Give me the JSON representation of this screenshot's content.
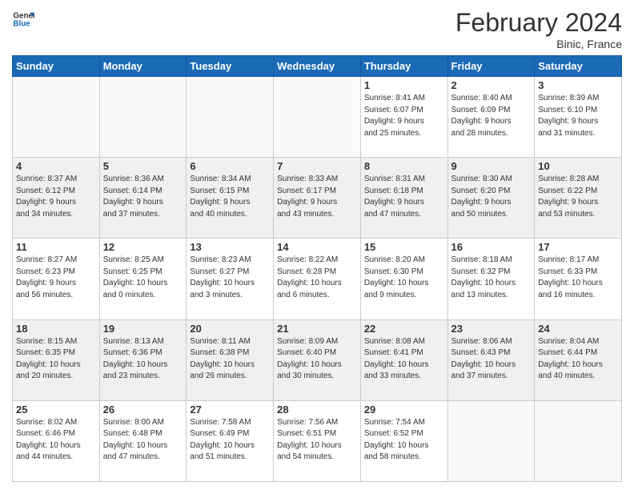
{
  "logo": {
    "line1": "General",
    "line2": "Blue"
  },
  "title": "February 2024",
  "location": "Binic, France",
  "days_of_week": [
    "Sunday",
    "Monday",
    "Tuesday",
    "Wednesday",
    "Thursday",
    "Friday",
    "Saturday"
  ],
  "weeks": [
    [
      {
        "day": "",
        "info": ""
      },
      {
        "day": "",
        "info": ""
      },
      {
        "day": "",
        "info": ""
      },
      {
        "day": "",
        "info": ""
      },
      {
        "day": "1",
        "info": "Sunrise: 8:41 AM\nSunset: 6:07 PM\nDaylight: 9 hours\nand 25 minutes."
      },
      {
        "day": "2",
        "info": "Sunrise: 8:40 AM\nSunset: 6:09 PM\nDaylight: 9 hours\nand 28 minutes."
      },
      {
        "day": "3",
        "info": "Sunrise: 8:39 AM\nSunset: 6:10 PM\nDaylight: 9 hours\nand 31 minutes."
      }
    ],
    [
      {
        "day": "4",
        "info": "Sunrise: 8:37 AM\nSunset: 6:12 PM\nDaylight: 9 hours\nand 34 minutes."
      },
      {
        "day": "5",
        "info": "Sunrise: 8:36 AM\nSunset: 6:14 PM\nDaylight: 9 hours\nand 37 minutes."
      },
      {
        "day": "6",
        "info": "Sunrise: 8:34 AM\nSunset: 6:15 PM\nDaylight: 9 hours\nand 40 minutes."
      },
      {
        "day": "7",
        "info": "Sunrise: 8:33 AM\nSunset: 6:17 PM\nDaylight: 9 hours\nand 43 minutes."
      },
      {
        "day": "8",
        "info": "Sunrise: 8:31 AM\nSunset: 6:18 PM\nDaylight: 9 hours\nand 47 minutes."
      },
      {
        "day": "9",
        "info": "Sunrise: 8:30 AM\nSunset: 6:20 PM\nDaylight: 9 hours\nand 50 minutes."
      },
      {
        "day": "10",
        "info": "Sunrise: 8:28 AM\nSunset: 6:22 PM\nDaylight: 9 hours\nand 53 minutes."
      }
    ],
    [
      {
        "day": "11",
        "info": "Sunrise: 8:27 AM\nSunset: 6:23 PM\nDaylight: 9 hours\nand 56 minutes."
      },
      {
        "day": "12",
        "info": "Sunrise: 8:25 AM\nSunset: 6:25 PM\nDaylight: 10 hours\nand 0 minutes."
      },
      {
        "day": "13",
        "info": "Sunrise: 8:23 AM\nSunset: 6:27 PM\nDaylight: 10 hours\nand 3 minutes."
      },
      {
        "day": "14",
        "info": "Sunrise: 8:22 AM\nSunset: 6:28 PM\nDaylight: 10 hours\nand 6 minutes."
      },
      {
        "day": "15",
        "info": "Sunrise: 8:20 AM\nSunset: 6:30 PM\nDaylight: 10 hours\nand 9 minutes."
      },
      {
        "day": "16",
        "info": "Sunrise: 8:18 AM\nSunset: 6:32 PM\nDaylight: 10 hours\nand 13 minutes."
      },
      {
        "day": "17",
        "info": "Sunrise: 8:17 AM\nSunset: 6:33 PM\nDaylight: 10 hours\nand 16 minutes."
      }
    ],
    [
      {
        "day": "18",
        "info": "Sunrise: 8:15 AM\nSunset: 6:35 PM\nDaylight: 10 hours\nand 20 minutes."
      },
      {
        "day": "19",
        "info": "Sunrise: 8:13 AM\nSunset: 6:36 PM\nDaylight: 10 hours\nand 23 minutes."
      },
      {
        "day": "20",
        "info": "Sunrise: 8:11 AM\nSunset: 6:38 PM\nDaylight: 10 hours\nand 26 minutes."
      },
      {
        "day": "21",
        "info": "Sunrise: 8:09 AM\nSunset: 6:40 PM\nDaylight: 10 hours\nand 30 minutes."
      },
      {
        "day": "22",
        "info": "Sunrise: 8:08 AM\nSunset: 6:41 PM\nDaylight: 10 hours\nand 33 minutes."
      },
      {
        "day": "23",
        "info": "Sunrise: 8:06 AM\nSunset: 6:43 PM\nDaylight: 10 hours\nand 37 minutes."
      },
      {
        "day": "24",
        "info": "Sunrise: 8:04 AM\nSunset: 6:44 PM\nDaylight: 10 hours\nand 40 minutes."
      }
    ],
    [
      {
        "day": "25",
        "info": "Sunrise: 8:02 AM\nSunset: 6:46 PM\nDaylight: 10 hours\nand 44 minutes."
      },
      {
        "day": "26",
        "info": "Sunrise: 8:00 AM\nSunset: 6:48 PM\nDaylight: 10 hours\nand 47 minutes."
      },
      {
        "day": "27",
        "info": "Sunrise: 7:58 AM\nSunset: 6:49 PM\nDaylight: 10 hours\nand 51 minutes."
      },
      {
        "day": "28",
        "info": "Sunrise: 7:56 AM\nSunset: 6:51 PM\nDaylight: 10 hours\nand 54 minutes."
      },
      {
        "day": "29",
        "info": "Sunrise: 7:54 AM\nSunset: 6:52 PM\nDaylight: 10 hours\nand 58 minutes."
      },
      {
        "day": "",
        "info": ""
      },
      {
        "day": "",
        "info": ""
      }
    ]
  ]
}
